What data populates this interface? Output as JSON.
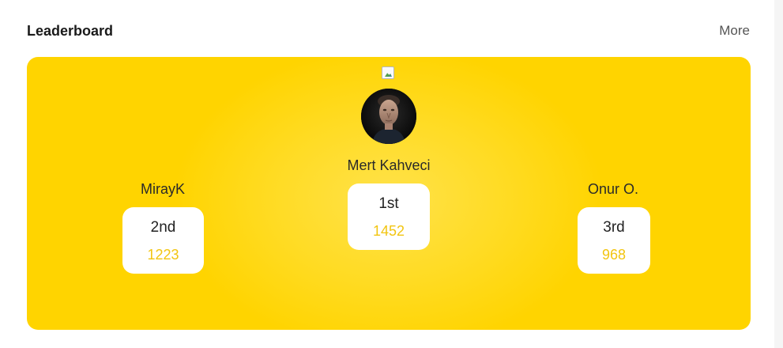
{
  "header": {
    "title": "Leaderboard",
    "more_label": "More"
  },
  "podium": {
    "first": {
      "name": "Mert Kahveci",
      "rank": "1st",
      "score": "1452"
    },
    "second": {
      "name": "MirayK",
      "rank": "2nd",
      "score": "1223"
    },
    "third": {
      "name": "Onur O.",
      "rank": "3rd",
      "score": "968"
    }
  },
  "colors": {
    "podium_background": "#ffd400",
    "score_text": "#f2c511",
    "card_background": "#ffffff"
  },
  "icons": {
    "crown": "broken-image-icon",
    "avatar": "user-avatar"
  }
}
